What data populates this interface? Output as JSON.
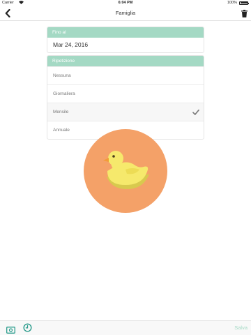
{
  "status_bar": {
    "carrier": "Carrier",
    "time": "6:04 PM",
    "battery": "100%"
  },
  "nav": {
    "title": "Famiglia",
    "back_icon": "chevron-left-icon",
    "delete_icon": "trash-icon"
  },
  "until_section": {
    "header": "Fino al",
    "date": "Mar 24, 2016"
  },
  "repeat_section": {
    "header": "Ripetizione",
    "options": [
      "Nessuna",
      "Giornaliera",
      "Mensile",
      "Annuale"
    ],
    "selected": "Mensile"
  },
  "mascot": {
    "icon": "duck-icon",
    "circle_color": "#f4a168",
    "duck_color": "#f6e96c"
  },
  "toolbar": {
    "money_icon": "money-icon",
    "clock_icon": "clock-icon",
    "save_label": "Salva"
  },
  "colors": {
    "accent": "#a4d9c4",
    "teal_icon": "#2a9c8c"
  }
}
